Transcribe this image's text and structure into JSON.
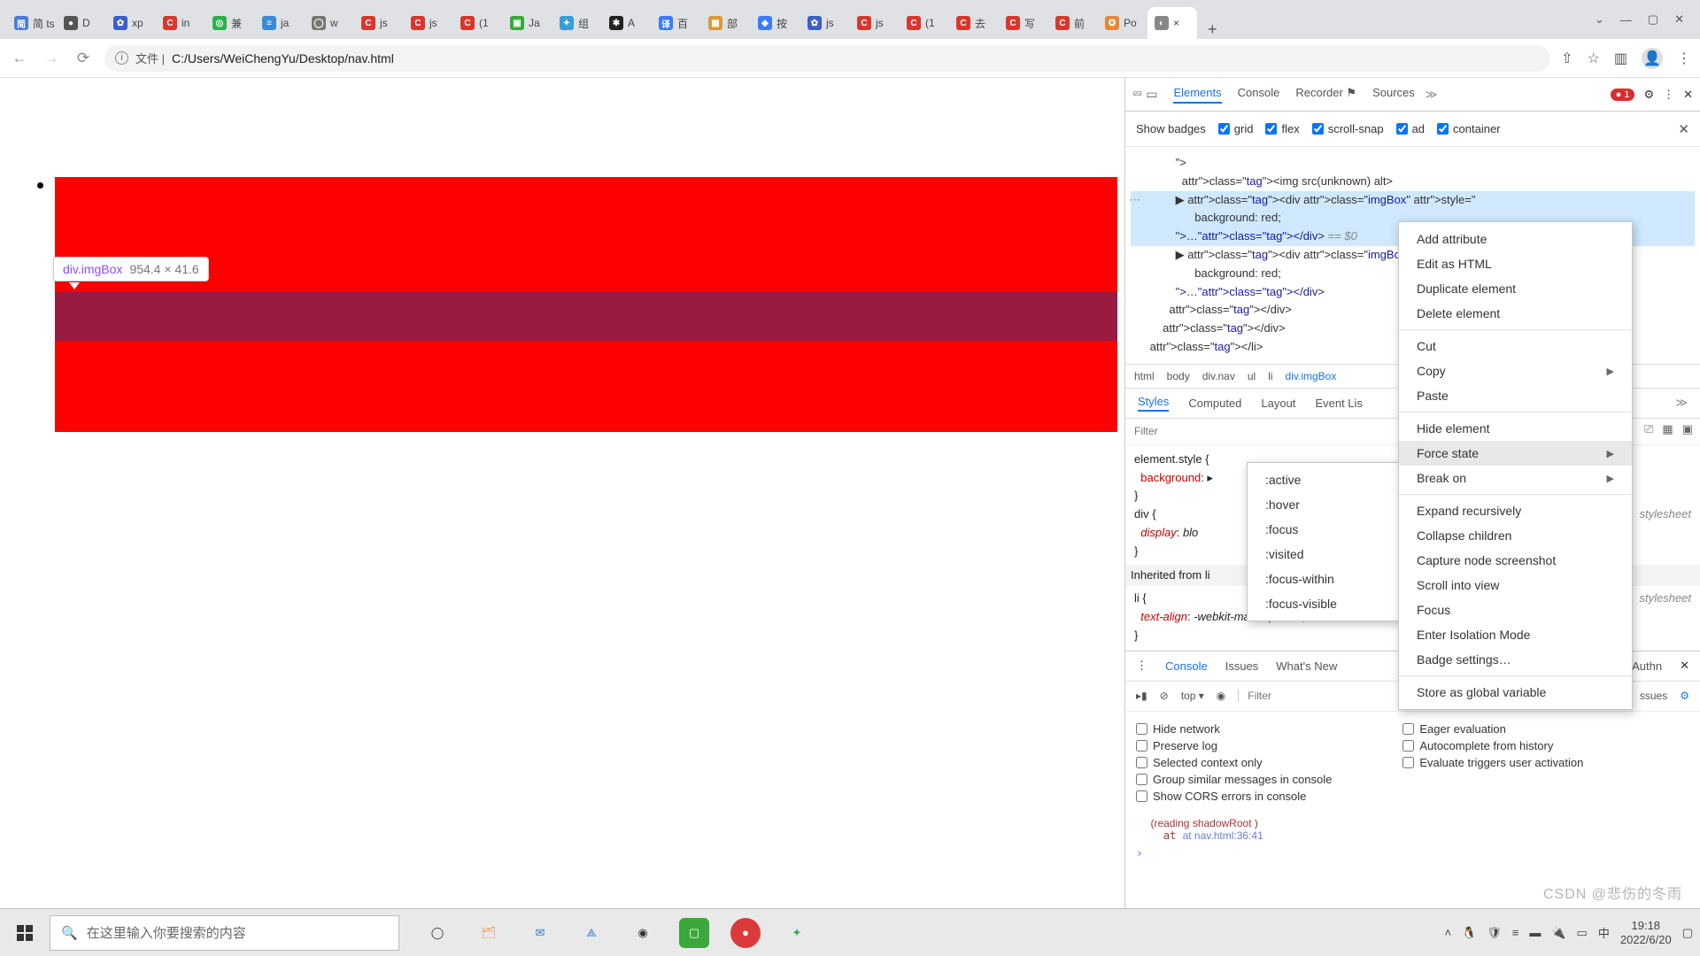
{
  "tabs": [
    {
      "label": "简 ts",
      "fav": "#4d7bd6",
      "t": "简"
    },
    {
      "label": "D",
      "fav": "#555",
      "t": "●"
    },
    {
      "label": "xp",
      "fav": "#3a5fcd",
      "t": "✿"
    },
    {
      "label": "in",
      "fav": "#d9372c",
      "t": "C"
    },
    {
      "label": "兼",
      "fav": "#2bb14c",
      "t": "◎"
    },
    {
      "label": "ja",
      "fav": "#3a8ad6",
      "t": "≡"
    },
    {
      "label": "w",
      "fav": "#777",
      "t": "◯"
    },
    {
      "label": "js",
      "fav": "#d9372c",
      "t": "C"
    },
    {
      "label": "js",
      "fav": "#d9372c",
      "t": "C"
    },
    {
      "label": "(1",
      "fav": "#d9372c",
      "t": "C"
    },
    {
      "label": "Ja",
      "fav": "#3aa83a",
      "t": "▣"
    },
    {
      "label": "组",
      "fav": "#3a9bd6",
      "t": "✦"
    },
    {
      "label": "A",
      "fav": "#222",
      "t": "✱"
    },
    {
      "label": "百",
      "fav": "#3a7bff",
      "t": "译"
    },
    {
      "label": "部",
      "fav": "#d93",
      "t": "▦"
    },
    {
      "label": "按",
      "fav": "#3a7bff",
      "t": "◆"
    },
    {
      "label": "js",
      "fav": "#3a5fcd",
      "t": "✿"
    },
    {
      "label": "js",
      "fav": "#d9372c",
      "t": "C"
    },
    {
      "label": "(1",
      "fav": "#d9372c",
      "t": "C"
    },
    {
      "label": "去",
      "fav": "#d9372c",
      "t": "C"
    },
    {
      "label": "写",
      "fav": "#d9372c",
      "t": "C"
    },
    {
      "label": "前",
      "fav": "#d9372c",
      "t": "C"
    },
    {
      "label": "Po",
      "fav": "#e8863a",
      "t": "✪"
    }
  ],
  "active_tab_close": "×",
  "new_tab_plus": "+",
  "address": {
    "secure_label": "文件",
    "path": "C:/Users/WeiChengYu/Desktop/nav.html"
  },
  "overlay": {
    "selector": "div.imgBox",
    "size": "954.4 × 41.6"
  },
  "devtools": {
    "tabs": [
      "Elements",
      "Console",
      "Recorder ⚑",
      "Sources"
    ],
    "more": "≫",
    "error_count": "1",
    "badges_label": "Show badges",
    "badges": [
      "grid",
      "flex",
      "scroll-snap",
      "ad",
      "container"
    ],
    "dom_lines": [
      {
        "indent": 7,
        "html": "\">"
      },
      {
        "indent": 8,
        "html": "<img src(unknown) alt>",
        "tag": true
      },
      {
        "indent": 7,
        "html": "▶ <div class=\"imgBox\" style=\"",
        "hl": true,
        "ell": true
      },
      {
        "indent": 10,
        "html": "background: red;",
        "hl": true
      },
      {
        "indent": 7,
        "html": "\">…</div> == $0",
        "hl": true,
        "sel": true
      },
      {
        "indent": 7,
        "html": "▶ <div class=\"imgBox\" s"
      },
      {
        "indent": 10,
        "html": "background: red;"
      },
      {
        "indent": 7,
        "html": "\">…</div>"
      },
      {
        "indent": 6,
        "html": "</div>"
      },
      {
        "indent": 5,
        "html": "</div>"
      },
      {
        "indent": 3,
        "html": "</li>"
      }
    ],
    "crumbs": [
      "html",
      "body",
      "div.nav",
      "ul",
      "li",
      "div.imgBox"
    ],
    "sub_tabs": [
      "Styles",
      "Computed",
      "Layout",
      "Event Lis"
    ],
    "filter_placeholder": "Filter",
    "styles": {
      "element_style": "element.style {",
      "bg_prop": "background",
      "bg_val": "▸",
      "div_rule": "div {",
      "display_prop": "display",
      "display_val": "blo",
      "stylesheet": "stylesheet",
      "inherited": "Inherited from li",
      "li_rule": "li {",
      "ta_prop": "text-align",
      "ta_val": "-webkit-match-parent"
    },
    "drawer_tabs": [
      "Console",
      "Issues",
      "What's New"
    ],
    "console": {
      "top": "top ▾",
      "filter_placeholder": "Filter",
      "left": [
        "Hide network",
        "Preserve log",
        "Selected context only",
        "Group similar messages in console",
        "Show CORS errors in console"
      ],
      "right": [
        "Eager evaluation",
        "Autocomplete from history",
        "Evaluate triggers user activation"
      ],
      "err_line1": "(reading  shadowRoot )",
      "err_line2": "at nav.html:36:41",
      "authn": "Authn",
      "issues_label": "ssues"
    }
  },
  "context_menu": {
    "groups": [
      [
        "Add attribute",
        "Edit as HTML",
        "Duplicate element",
        "Delete element"
      ],
      [
        "Cut",
        "Copy ▸",
        "Paste"
      ],
      [
        "Hide element",
        "Force state ▸",
        "Break on ▸"
      ],
      [
        "Expand recursively",
        "Collapse children",
        "Capture node screenshot",
        "Scroll into view",
        "Focus",
        "Enter Isolation Mode",
        "Badge settings…"
      ],
      [
        "Store as global variable"
      ]
    ],
    "hover": "Force state ▸"
  },
  "force_state": [
    ":active",
    ":hover",
    ":focus",
    ":visited",
    ":focus-within",
    ":focus-visible"
  ],
  "taskbar": {
    "search_placeholder": "在这里输入你要搜索的内容",
    "time": "19:18",
    "date": "2022/6/20"
  },
  "watermark": "CSDN @悲伤的冬雨"
}
